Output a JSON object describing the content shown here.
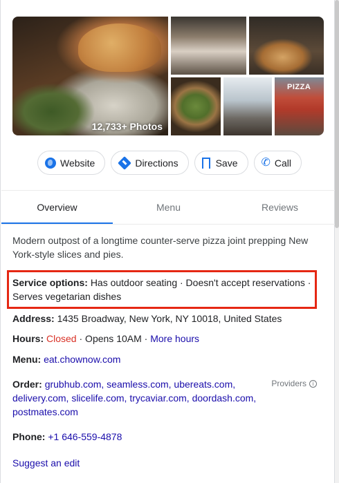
{
  "photos": {
    "count_badge": "12,733+ Photos",
    "storefront_sign": "PIZZA"
  },
  "actions": [
    {
      "label": "Website",
      "icon": "globe-icon"
    },
    {
      "label": "Directions",
      "icon": "directions-icon"
    },
    {
      "label": "Save",
      "icon": "bookmark-icon"
    },
    {
      "label": "Call",
      "icon": "phone-icon"
    }
  ],
  "tabs": [
    "Overview",
    "Menu",
    "Reviews"
  ],
  "description": "Modern outpost of a longtime counter-serve pizza joint prepping New York-style slices and pies.",
  "service_options": {
    "label": "Service options:",
    "value": "Has outdoor seating · Doesn't accept reservations · Serves vegetarian dishes"
  },
  "address": {
    "label": "Address:",
    "value": "1435 Broadway, New York, NY 10018, United States"
  },
  "hours": {
    "label": "Hours:",
    "status": "Closed",
    "opens": "· Opens 10AM ·",
    "more": "More hours"
  },
  "menu": {
    "label": "Menu:",
    "link": "eat.chownow.com"
  },
  "order": {
    "label": "Order:",
    "links_line1": "grubhub.com, seamless.com, ubereats.com,",
    "links_line2": "delivery.com, slicelife.com, trycaviar.com, doordash.com,",
    "links_line3": "postmates.com",
    "providers": "Providers"
  },
  "phone": {
    "label": "Phone:",
    "value": "+1 646-559-4878"
  },
  "suggest_edit": "Suggest an edit",
  "colors": {
    "link": "#1a0dab",
    "accent": "#1a73e8",
    "closed": "#d93025",
    "highlight": "#e52713"
  }
}
